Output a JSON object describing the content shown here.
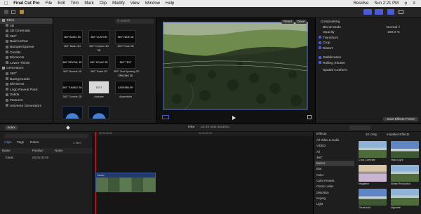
{
  "menubar": {
    "app": "Final Cut Pro",
    "items": [
      "File",
      "Edit",
      "Trim",
      "Mark",
      "Clip",
      "Modify",
      "View",
      "Window",
      "Help"
    ],
    "right_app": "Resolve",
    "clock": "Sun 2:21 PM"
  },
  "sidebar": {
    "items": [
      {
        "label": "Titles",
        "level": 0
      },
      {
        "label": "3D",
        "level": 1
      },
      {
        "label": "3D Cinematic",
        "level": 1
      },
      {
        "label": "360°",
        "level": 1
      },
      {
        "label": "Build In/Out",
        "level": 1
      },
      {
        "label": "Bumper/Opener",
        "level": 1
      },
      {
        "label": "Credits",
        "level": 1
      },
      {
        "label": "Elements",
        "level": 1
      },
      {
        "label": "Lower Thirds",
        "level": 1
      },
      {
        "label": "Generators",
        "level": 0
      },
      {
        "label": "360°",
        "level": 1
      },
      {
        "label": "Backgrounds",
        "level": 1
      },
      {
        "label": "Elements",
        "level": 1
      },
      {
        "label": "Logo Reveal Pack",
        "level": 1
      },
      {
        "label": "Solids",
        "level": 1
      },
      {
        "label": "Textures",
        "level": 1
      },
      {
        "label": "Universe Generators",
        "level": 1
      }
    ]
  },
  "browser": {
    "search_placeholder": "Search",
    "thumbs": [
      {
        "text": "360° BASIC 3D",
        "label": "360° Basic 3D"
      },
      {
        "text": "360° CUSTOM 3D",
        "label": "360° Custom 3D"
      },
      {
        "text": "360° FADE 3D",
        "label": "360° Fade 3D"
      },
      {
        "text": "360° REVEAL 3D",
        "label": "360° Reveal 3D"
      },
      {
        "text": "360° SCALE 3D",
        "label": "360° Scale 3D"
      },
      {
        "text": "360° TEXT SPACING 3D",
        "label": "360° Text Spacing 3D"
      },
      {
        "text": "360° TUMBLE 3D",
        "label": "360° Tumble 3D"
      },
      {
        "text": "TEXT",
        "label": "Activate"
      },
      {
        "text": "ASSEMBLER",
        "label": "Assembler"
      }
    ]
  },
  "viewer": {
    "reset_label": "Reset",
    "done_label": "Done"
  },
  "inspector": {
    "section": "Compositing",
    "rows": [
      {
        "label": "Blend Mode",
        "value": "Normal ◊",
        "check": false
      },
      {
        "label": "Opacity",
        "value": "100.0 %",
        "check": false
      },
      {
        "label": "Transform",
        "value": "",
        "check": true
      },
      {
        "label": "Crop",
        "value": "",
        "check": true
      },
      {
        "label": "Distort",
        "value": "",
        "check": true
      },
      {
        "label": "Stabilization",
        "value": "",
        "check": true
      },
      {
        "label": "Rolling Shutter",
        "value": "",
        "check": true
      },
      {
        "label": "Spatial Conform",
        "value": "",
        "check": false
      }
    ],
    "save_preset": "Save Effects Preset"
  },
  "timeline_bar": {
    "index_label": "Index",
    "project_label": "Hike",
    "duration_text": "02:29 total duration"
  },
  "index": {
    "tabs": [
      "Clips",
      "Tags",
      "Roles"
    ],
    "item_count": "1 item",
    "columns": [
      "Name",
      "Position",
      "Notes"
    ],
    "rows": [
      {
        "name": "Hike",
        "position": "00:00:00:00",
        "notes": ""
      },
      {
        "name": "forest",
        "position": "00:00:00:00",
        "notes": ""
      }
    ]
  },
  "timeline": {
    "clip_label": "forest",
    "ruler": [
      "00:00:00:00",
      "00:00:05:00"
    ]
  },
  "effects": {
    "title": "Effects",
    "only_4k": "4K Only",
    "installed": "Installed Effects",
    "categories": [
      "All Video & Audio",
      "VIDEO",
      "All",
      "360°",
      "Basics",
      "Blur",
      "Color",
      "Color Presets",
      "Comic Looks",
      "Distortion",
      "Keying",
      "Light"
    ],
    "selected_category": "Basics",
    "items": [
      {
        "name": "Crop Contrast",
        "tone": "a"
      },
      {
        "name": "Hard Light",
        "tone": "b"
      },
      {
        "name": "Negative",
        "tone": "c"
      },
      {
        "name": "Noise Reduction",
        "tone": "a"
      },
      {
        "name": "Threshold",
        "tone": "b"
      },
      {
        "name": "Vignette",
        "tone": "a"
      }
    ]
  },
  "colors": {
    "accent": "#4b5bd6",
    "panel": "#1e1e1e",
    "menubar": "#e9e9e9"
  }
}
